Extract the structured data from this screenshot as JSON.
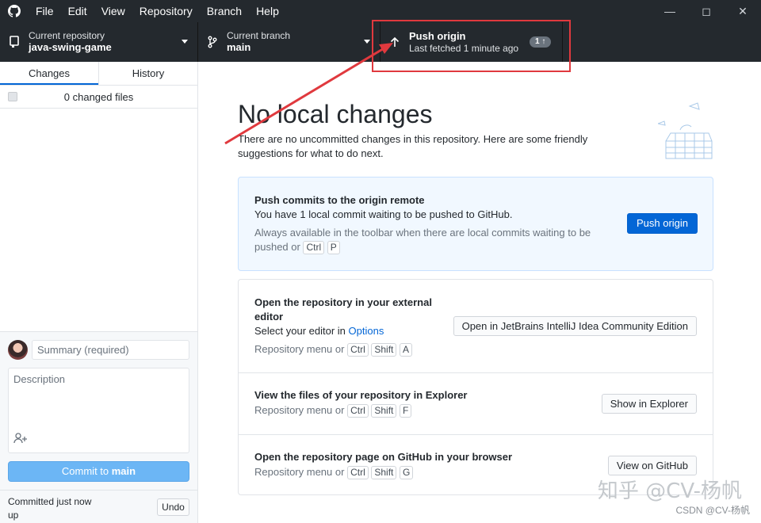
{
  "menu": [
    "File",
    "Edit",
    "View",
    "Repository",
    "Branch",
    "Help"
  ],
  "toolbar": {
    "repo_label": "Current repository",
    "repo_name": "java-swing-game",
    "branch_label": "Current branch",
    "branch_name": "main",
    "push_title": "Push origin",
    "push_sub": "Last fetched 1 minute ago",
    "push_badge": "1 ↑"
  },
  "sidebar": {
    "tabs": [
      "Changes",
      "History"
    ],
    "changed_files": "0 changed files",
    "summary_placeholder": "Summary (required)",
    "description_placeholder": "Description",
    "commit_prefix": "Commit to ",
    "commit_branch": "main",
    "committed_text": "Committed just now",
    "committed_text2": "up",
    "undo": "Undo"
  },
  "main": {
    "heading": "No local changes",
    "subtext": "There are no uncommitted changes in this repository. Here are some friendly suggestions for what to do next.",
    "push_card": {
      "title": "Push commits to the origin remote",
      "text": "You have 1 local commit waiting to be pushed to GitHub.",
      "muted": "Always available in the toolbar when there are local commits waiting to be",
      "muted2": "pushed or",
      "keys": [
        "Ctrl",
        "P"
      ],
      "button": "Push origin"
    },
    "editor_card": {
      "title": "Open the repository in your external",
      "title2": "editor",
      "text": "Select your editor in",
      "link": "Options",
      "muted": "Repository menu or",
      "keys": [
        "Ctrl",
        "Shift",
        "A"
      ],
      "button": "Open in JetBrains IntelliJ Idea Community Edition"
    },
    "explorer_card": {
      "title": "View the files of your repository in Explorer",
      "muted": "Repository menu or",
      "keys": [
        "Ctrl",
        "Shift",
        "F"
      ],
      "button": "Show in Explorer"
    },
    "github_card": {
      "title": "Open the repository page on GitHub in your browser",
      "muted": "Repository menu or",
      "keys": [
        "Ctrl",
        "Shift",
        "G"
      ],
      "button": "View on GitHub"
    }
  },
  "watermark": "知乎 @CV-杨帆",
  "watermark_small": "CSDN @CV-杨帆",
  "colors": {
    "titlebar": "#24292e",
    "accent": "#0366d6",
    "annotation": "#e0393e"
  }
}
